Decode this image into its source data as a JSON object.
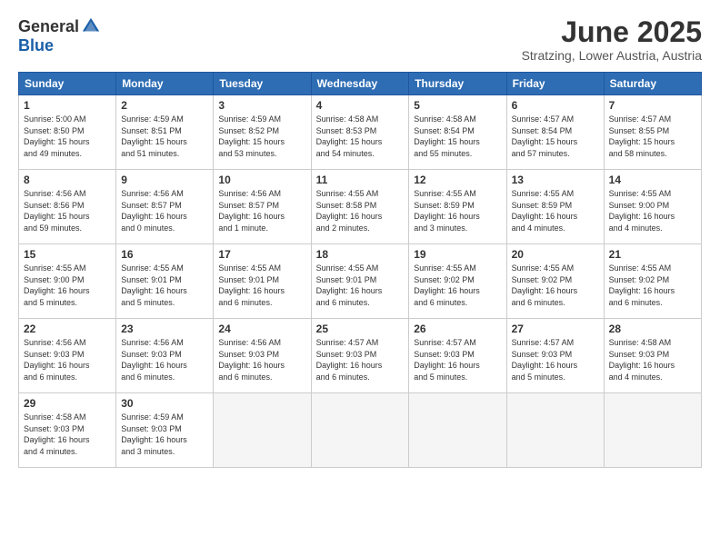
{
  "logo": {
    "general": "General",
    "blue": "Blue"
  },
  "title": "June 2025",
  "subtitle": "Stratzing, Lower Austria, Austria",
  "days_of_week": [
    "Sunday",
    "Monday",
    "Tuesday",
    "Wednesday",
    "Thursday",
    "Friday",
    "Saturday"
  ],
  "weeks": [
    [
      {
        "day": "1",
        "info": "Sunrise: 5:00 AM\nSunset: 8:50 PM\nDaylight: 15 hours\nand 49 minutes."
      },
      {
        "day": "2",
        "info": "Sunrise: 4:59 AM\nSunset: 8:51 PM\nDaylight: 15 hours\nand 51 minutes."
      },
      {
        "day": "3",
        "info": "Sunrise: 4:59 AM\nSunset: 8:52 PM\nDaylight: 15 hours\nand 53 minutes."
      },
      {
        "day": "4",
        "info": "Sunrise: 4:58 AM\nSunset: 8:53 PM\nDaylight: 15 hours\nand 54 minutes."
      },
      {
        "day": "5",
        "info": "Sunrise: 4:58 AM\nSunset: 8:54 PM\nDaylight: 15 hours\nand 55 minutes."
      },
      {
        "day": "6",
        "info": "Sunrise: 4:57 AM\nSunset: 8:54 PM\nDaylight: 15 hours\nand 57 minutes."
      },
      {
        "day": "7",
        "info": "Sunrise: 4:57 AM\nSunset: 8:55 PM\nDaylight: 15 hours\nand 58 minutes."
      }
    ],
    [
      {
        "day": "8",
        "info": "Sunrise: 4:56 AM\nSunset: 8:56 PM\nDaylight: 15 hours\nand 59 minutes."
      },
      {
        "day": "9",
        "info": "Sunrise: 4:56 AM\nSunset: 8:57 PM\nDaylight: 16 hours\nand 0 minutes."
      },
      {
        "day": "10",
        "info": "Sunrise: 4:56 AM\nSunset: 8:57 PM\nDaylight: 16 hours\nand 1 minute."
      },
      {
        "day": "11",
        "info": "Sunrise: 4:55 AM\nSunset: 8:58 PM\nDaylight: 16 hours\nand 2 minutes."
      },
      {
        "day": "12",
        "info": "Sunrise: 4:55 AM\nSunset: 8:59 PM\nDaylight: 16 hours\nand 3 minutes."
      },
      {
        "day": "13",
        "info": "Sunrise: 4:55 AM\nSunset: 8:59 PM\nDaylight: 16 hours\nand 4 minutes."
      },
      {
        "day": "14",
        "info": "Sunrise: 4:55 AM\nSunset: 9:00 PM\nDaylight: 16 hours\nand 4 minutes."
      }
    ],
    [
      {
        "day": "15",
        "info": "Sunrise: 4:55 AM\nSunset: 9:00 PM\nDaylight: 16 hours\nand 5 minutes."
      },
      {
        "day": "16",
        "info": "Sunrise: 4:55 AM\nSunset: 9:01 PM\nDaylight: 16 hours\nand 5 minutes."
      },
      {
        "day": "17",
        "info": "Sunrise: 4:55 AM\nSunset: 9:01 PM\nDaylight: 16 hours\nand 6 minutes."
      },
      {
        "day": "18",
        "info": "Sunrise: 4:55 AM\nSunset: 9:01 PM\nDaylight: 16 hours\nand 6 minutes."
      },
      {
        "day": "19",
        "info": "Sunrise: 4:55 AM\nSunset: 9:02 PM\nDaylight: 16 hours\nand 6 minutes."
      },
      {
        "day": "20",
        "info": "Sunrise: 4:55 AM\nSunset: 9:02 PM\nDaylight: 16 hours\nand 6 minutes."
      },
      {
        "day": "21",
        "info": "Sunrise: 4:55 AM\nSunset: 9:02 PM\nDaylight: 16 hours\nand 6 minutes."
      }
    ],
    [
      {
        "day": "22",
        "info": "Sunrise: 4:56 AM\nSunset: 9:03 PM\nDaylight: 16 hours\nand 6 minutes."
      },
      {
        "day": "23",
        "info": "Sunrise: 4:56 AM\nSunset: 9:03 PM\nDaylight: 16 hours\nand 6 minutes."
      },
      {
        "day": "24",
        "info": "Sunrise: 4:56 AM\nSunset: 9:03 PM\nDaylight: 16 hours\nand 6 minutes."
      },
      {
        "day": "25",
        "info": "Sunrise: 4:57 AM\nSunset: 9:03 PM\nDaylight: 16 hours\nand 6 minutes."
      },
      {
        "day": "26",
        "info": "Sunrise: 4:57 AM\nSunset: 9:03 PM\nDaylight: 16 hours\nand 5 minutes."
      },
      {
        "day": "27",
        "info": "Sunrise: 4:57 AM\nSunset: 9:03 PM\nDaylight: 16 hours\nand 5 minutes."
      },
      {
        "day": "28",
        "info": "Sunrise: 4:58 AM\nSunset: 9:03 PM\nDaylight: 16 hours\nand 4 minutes."
      }
    ],
    [
      {
        "day": "29",
        "info": "Sunrise: 4:58 AM\nSunset: 9:03 PM\nDaylight: 16 hours\nand 4 minutes."
      },
      {
        "day": "30",
        "info": "Sunrise: 4:59 AM\nSunset: 9:03 PM\nDaylight: 16 hours\nand 3 minutes."
      },
      null,
      null,
      null,
      null,
      null
    ]
  ]
}
